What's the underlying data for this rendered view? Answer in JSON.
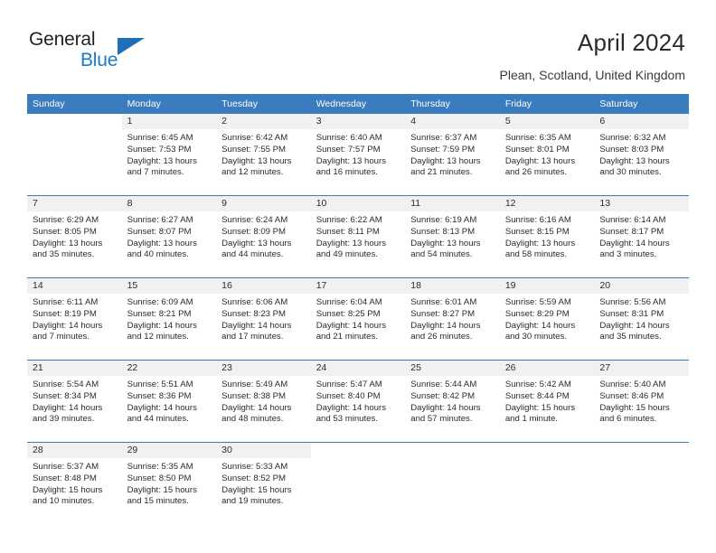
{
  "brand": {
    "line1": "General",
    "line2": "Blue",
    "triangle_color": "#1f6fb8",
    "blue_text_color": "#1f7ac4"
  },
  "header": {
    "title": "April 2024",
    "subtitle": "Plean, Scotland, United Kingdom",
    "accent_color": "#3a7cbd"
  },
  "calendar": {
    "weekday_headers": [
      "Sunday",
      "Monday",
      "Tuesday",
      "Wednesday",
      "Thursday",
      "Friday",
      "Saturday"
    ],
    "weeks": [
      [
        {
          "day": "",
          "lines": []
        },
        {
          "day": "1",
          "lines": [
            "Sunrise: 6:45 AM",
            "Sunset: 7:53 PM",
            "Daylight: 13 hours",
            "and 7 minutes."
          ]
        },
        {
          "day": "2",
          "lines": [
            "Sunrise: 6:42 AM",
            "Sunset: 7:55 PM",
            "Daylight: 13 hours",
            "and 12 minutes."
          ]
        },
        {
          "day": "3",
          "lines": [
            "Sunrise: 6:40 AM",
            "Sunset: 7:57 PM",
            "Daylight: 13 hours",
            "and 16 minutes."
          ]
        },
        {
          "day": "4",
          "lines": [
            "Sunrise: 6:37 AM",
            "Sunset: 7:59 PM",
            "Daylight: 13 hours",
            "and 21 minutes."
          ]
        },
        {
          "day": "5",
          "lines": [
            "Sunrise: 6:35 AM",
            "Sunset: 8:01 PM",
            "Daylight: 13 hours",
            "and 26 minutes."
          ]
        },
        {
          "day": "6",
          "lines": [
            "Sunrise: 6:32 AM",
            "Sunset: 8:03 PM",
            "Daylight: 13 hours",
            "and 30 minutes."
          ]
        }
      ],
      [
        {
          "day": "7",
          "lines": [
            "Sunrise: 6:29 AM",
            "Sunset: 8:05 PM",
            "Daylight: 13 hours",
            "and 35 minutes."
          ]
        },
        {
          "day": "8",
          "lines": [
            "Sunrise: 6:27 AM",
            "Sunset: 8:07 PM",
            "Daylight: 13 hours",
            "and 40 minutes."
          ]
        },
        {
          "day": "9",
          "lines": [
            "Sunrise: 6:24 AM",
            "Sunset: 8:09 PM",
            "Daylight: 13 hours",
            "and 44 minutes."
          ]
        },
        {
          "day": "10",
          "lines": [
            "Sunrise: 6:22 AM",
            "Sunset: 8:11 PM",
            "Daylight: 13 hours",
            "and 49 minutes."
          ]
        },
        {
          "day": "11",
          "lines": [
            "Sunrise: 6:19 AM",
            "Sunset: 8:13 PM",
            "Daylight: 13 hours",
            "and 54 minutes."
          ]
        },
        {
          "day": "12",
          "lines": [
            "Sunrise: 6:16 AM",
            "Sunset: 8:15 PM",
            "Daylight: 13 hours",
            "and 58 minutes."
          ]
        },
        {
          "day": "13",
          "lines": [
            "Sunrise: 6:14 AM",
            "Sunset: 8:17 PM",
            "Daylight: 14 hours",
            "and 3 minutes."
          ]
        }
      ],
      [
        {
          "day": "14",
          "lines": [
            "Sunrise: 6:11 AM",
            "Sunset: 8:19 PM",
            "Daylight: 14 hours",
            "and 7 minutes."
          ]
        },
        {
          "day": "15",
          "lines": [
            "Sunrise: 6:09 AM",
            "Sunset: 8:21 PM",
            "Daylight: 14 hours",
            "and 12 minutes."
          ]
        },
        {
          "day": "16",
          "lines": [
            "Sunrise: 6:06 AM",
            "Sunset: 8:23 PM",
            "Daylight: 14 hours",
            "and 17 minutes."
          ]
        },
        {
          "day": "17",
          "lines": [
            "Sunrise: 6:04 AM",
            "Sunset: 8:25 PM",
            "Daylight: 14 hours",
            "and 21 minutes."
          ]
        },
        {
          "day": "18",
          "lines": [
            "Sunrise: 6:01 AM",
            "Sunset: 8:27 PM",
            "Daylight: 14 hours",
            "and 26 minutes."
          ]
        },
        {
          "day": "19",
          "lines": [
            "Sunrise: 5:59 AM",
            "Sunset: 8:29 PM",
            "Daylight: 14 hours",
            "and 30 minutes."
          ]
        },
        {
          "day": "20",
          "lines": [
            "Sunrise: 5:56 AM",
            "Sunset: 8:31 PM",
            "Daylight: 14 hours",
            "and 35 minutes."
          ]
        }
      ],
      [
        {
          "day": "21",
          "lines": [
            "Sunrise: 5:54 AM",
            "Sunset: 8:34 PM",
            "Daylight: 14 hours",
            "and 39 minutes."
          ]
        },
        {
          "day": "22",
          "lines": [
            "Sunrise: 5:51 AM",
            "Sunset: 8:36 PM",
            "Daylight: 14 hours",
            "and 44 minutes."
          ]
        },
        {
          "day": "23",
          "lines": [
            "Sunrise: 5:49 AM",
            "Sunset: 8:38 PM",
            "Daylight: 14 hours",
            "and 48 minutes."
          ]
        },
        {
          "day": "24",
          "lines": [
            "Sunrise: 5:47 AM",
            "Sunset: 8:40 PM",
            "Daylight: 14 hours",
            "and 53 minutes."
          ]
        },
        {
          "day": "25",
          "lines": [
            "Sunrise: 5:44 AM",
            "Sunset: 8:42 PM",
            "Daylight: 14 hours",
            "and 57 minutes."
          ]
        },
        {
          "day": "26",
          "lines": [
            "Sunrise: 5:42 AM",
            "Sunset: 8:44 PM",
            "Daylight: 15 hours",
            "and 1 minute."
          ]
        },
        {
          "day": "27",
          "lines": [
            "Sunrise: 5:40 AM",
            "Sunset: 8:46 PM",
            "Daylight: 15 hours",
            "and 6 minutes."
          ]
        }
      ],
      [
        {
          "day": "28",
          "lines": [
            "Sunrise: 5:37 AM",
            "Sunset: 8:48 PM",
            "Daylight: 15 hours",
            "and 10 minutes."
          ]
        },
        {
          "day": "29",
          "lines": [
            "Sunrise: 5:35 AM",
            "Sunset: 8:50 PM",
            "Daylight: 15 hours",
            "and 15 minutes."
          ]
        },
        {
          "day": "30",
          "lines": [
            "Sunrise: 5:33 AM",
            "Sunset: 8:52 PM",
            "Daylight: 15 hours",
            "and 19 minutes."
          ]
        },
        {
          "day": "",
          "lines": []
        },
        {
          "day": "",
          "lines": []
        },
        {
          "day": "",
          "lines": []
        },
        {
          "day": "",
          "lines": []
        }
      ]
    ]
  }
}
